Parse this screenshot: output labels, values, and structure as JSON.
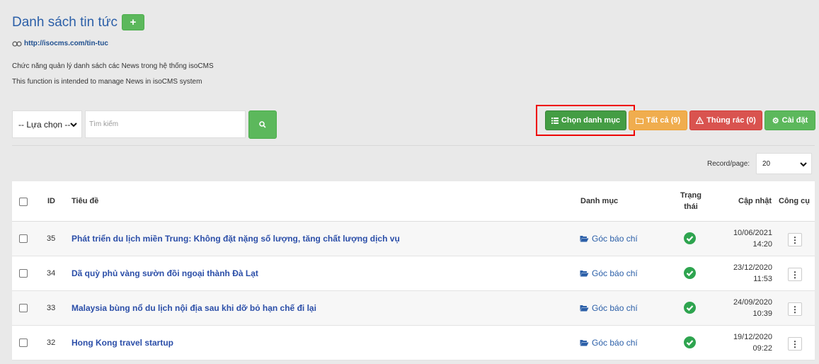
{
  "header": {
    "title": "Danh sách tin tức",
    "add_label": "+",
    "url": "http://isocms.com/tin-tuc",
    "description_vi": "Chức năng quản lý danh sách các News trong hệ thống isoCMS",
    "description_en": "This function is intended to manage News in isoCMS system"
  },
  "filters": {
    "select_value": "-- Lựa chọn --",
    "search_placeholder": "Tìm kiếm"
  },
  "toolbar": {
    "category_label": "Chọn danh mục",
    "all_label": "Tất cả (9)",
    "trash_label": "Thùng rác (0)",
    "settings_label": "Cài đặt"
  },
  "pagination": {
    "record_label": "Record/page:",
    "record_value": "20"
  },
  "table": {
    "headers": {
      "id": "ID",
      "title": "Tiêu đề",
      "category": "Danh mục",
      "status_line1": "Trạng",
      "status_line2": "thái",
      "updated": "Cập nhật",
      "tools": "Công cụ"
    },
    "rows": [
      {
        "id": "35",
        "title": "Phát triển du lịch miền Trung: Không đặt nặng số lượng, tăng chất lượng dịch vụ",
        "category": "Góc báo chí",
        "date": "10/06/2021",
        "time": "14:20"
      },
      {
        "id": "34",
        "title": "Dã quỳ phủ vàng sườn đồi ngoại thành Đà Lạt",
        "category": "Góc báo chí",
        "date": "23/12/2020",
        "time": "11:53"
      },
      {
        "id": "33",
        "title": "Malaysia bùng nổ du lịch nội địa sau khi dỡ bỏ hạn chế đi lại",
        "category": "Góc báo chí",
        "date": "24/09/2020",
        "time": "10:39"
      },
      {
        "id": "32",
        "title": "Hong Kong travel startup",
        "category": "Góc báo chí",
        "date": "19/12/2020",
        "time": "09:22"
      }
    ]
  },
  "colors": {
    "accent": "#2b5fa8",
    "success": "#5cb85c",
    "warning": "#f0ad4e",
    "danger": "#d9534f",
    "highlight": "#e00000"
  }
}
